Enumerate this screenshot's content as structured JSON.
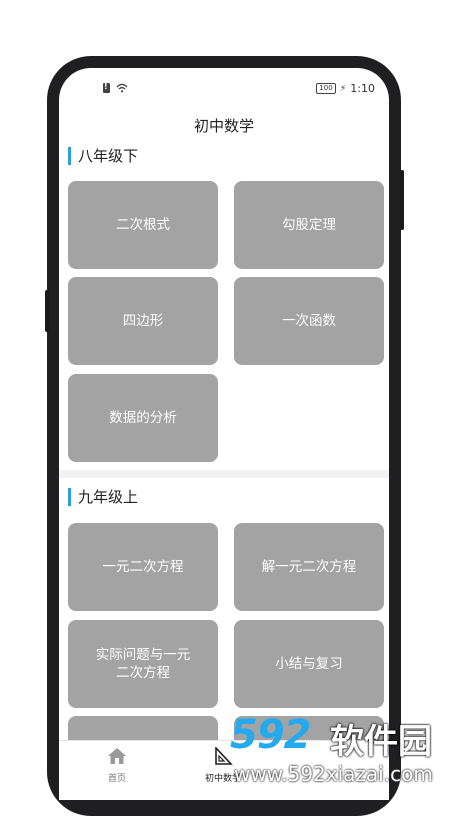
{
  "status": {
    "time": "1:10",
    "battery": "100"
  },
  "header": {
    "title": "初中数学"
  },
  "sections": [
    {
      "title": "八年级下",
      "items": [
        "二次根式",
        "勾股定理",
        "四边形",
        "一次函数",
        "数据的分析"
      ]
    },
    {
      "title": "九年级上",
      "items": [
        "一元二次方程",
        "解一元二次方程",
        "实际问题与一元\n二次方程",
        "小结与复习"
      ]
    }
  ],
  "nav": {
    "home": "首页",
    "math": "初中数学"
  },
  "watermark": {
    "logo": "592",
    "name": "软件园",
    "url": "www.592xiazai.com"
  },
  "colors": {
    "accent": "#2a9fe0",
    "tile": "#a3a3a3",
    "watermark": "#24a9ef"
  }
}
